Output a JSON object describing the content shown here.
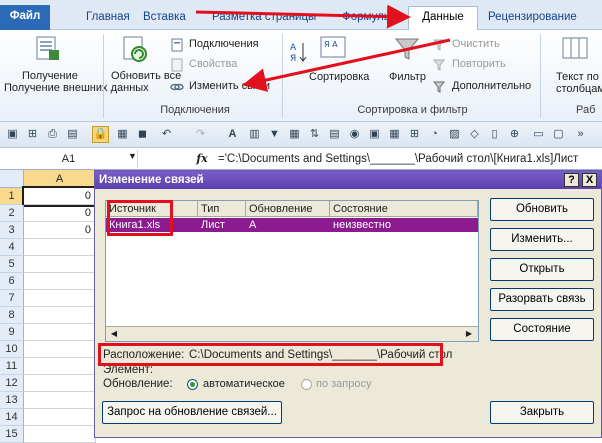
{
  "ribbon_tabs": [
    "Файл",
    "Главная",
    "Вставка",
    "Разметка страницы",
    "Формулы",
    "Данные",
    "Рецензирование"
  ],
  "ribbon": {
    "get_external": "Получение внешних данных",
    "refresh_all": "Обновить все",
    "connections": "Подключения",
    "properties": "Свойства",
    "edit_links": "Изменить связи",
    "connections_group": "Подключения",
    "sort": "Сортировка",
    "filter": "Фильтр",
    "clear": "Очистить",
    "reapply": "Повторить",
    "advanced": "Дополнительно",
    "sortfilter_group": "Сортировка и фильтр",
    "text_to_columns": "Текст по столбцам",
    "work_group": "Раб"
  },
  "formula_bar": {
    "cell_ref": "A1",
    "fx": "fx",
    "formula": "='C:\\Documents and Settings\\_______\\Рабочий стол\\[Книга1.xls]Лист"
  },
  "sheet": {
    "col_a": "A",
    "rows": [
      {
        "num": "1",
        "value": "0"
      },
      {
        "num": "2",
        "value": "0"
      },
      {
        "num": "3",
        "value": "0"
      },
      {
        "num": "4",
        "value": ""
      },
      {
        "num": "5",
        "value": ""
      },
      {
        "num": "6",
        "value": ""
      },
      {
        "num": "7",
        "value": ""
      },
      {
        "num": "8",
        "value": ""
      },
      {
        "num": "9",
        "value": ""
      },
      {
        "num": "10",
        "value": ""
      },
      {
        "num": "11",
        "value": ""
      },
      {
        "num": "12",
        "value": ""
      },
      {
        "num": "13",
        "value": ""
      },
      {
        "num": "14",
        "value": ""
      },
      {
        "num": "15",
        "value": ""
      }
    ]
  },
  "dialog": {
    "title": "Изменение связей",
    "help": "?",
    "close": "X",
    "columns": [
      "Источник",
      "Тип",
      "Обновление",
      "Состояние"
    ],
    "row": {
      "source": "Книга1.xls",
      "type": "Лист",
      "update": "A",
      "status": "неизвестно"
    },
    "buttons": {
      "update": "Обновить",
      "change": "Изменить...",
      "open": "Открыть",
      "break": "Разорвать связь",
      "status": "Состояние",
      "close": "Закрыть",
      "request": "Запрос на обновление связей..."
    },
    "location_label": "Расположение:",
    "location_value": "C:\\Documents and Settings\\_______\\Рабочий стол",
    "element_label": "Элемент:",
    "update_label": "Обновление:",
    "auto": "автоматическое",
    "manual": "по запросу"
  },
  "colors": {
    "accent": "#e2101c",
    "title": "#5b3fae",
    "selection": "#8b1b8f"
  }
}
